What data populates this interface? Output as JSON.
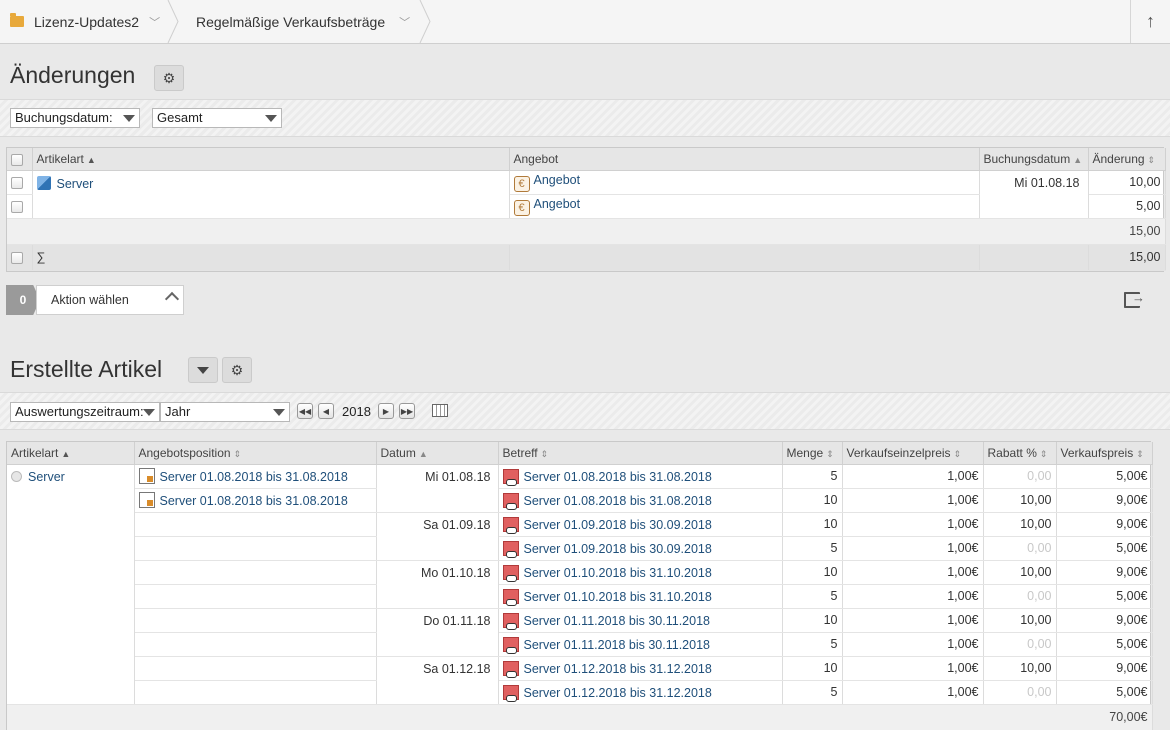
{
  "breadcrumb": {
    "items": [
      {
        "label": "Lizenz-Updates2"
      },
      {
        "label": "Regelmäßige Verkaufsbeträge"
      }
    ],
    "up_label": "↑"
  },
  "changes": {
    "title": "Änderungen",
    "filter": {
      "field": "Buchungsdatum:",
      "range": "Gesamt"
    },
    "columns": {
      "artikelart": "Artikelart",
      "angebot": "Angebot",
      "buchungsdatum": "Buchungsdatum",
      "aenderung": "Änderung"
    },
    "rows": [
      {
        "artikelart": "Server",
        "angebot": "Angebot",
        "buchungsdatum": "Mi 01.08.18",
        "aenderung": "10,00"
      },
      {
        "artikelart": "",
        "angebot": "Angebot",
        "buchungsdatum": "",
        "aenderung": "5,00"
      }
    ],
    "total": "15,00",
    "sigma_label": "∑",
    "sigma_total": "15,00",
    "action": {
      "count": "0",
      "label": "Aktion wählen"
    }
  },
  "articles": {
    "title": "Erstellte Artikel",
    "filter": {
      "field": "Auswertungszeitraum:",
      "range": "Jahr",
      "year": "2018"
    },
    "columns": {
      "artikelart": "Artikelart",
      "angebotsposition": "Angebotsposition",
      "datum": "Datum",
      "betreff": "Betreff",
      "menge": "Menge",
      "vkeinzel": "Verkaufseinzelpreis",
      "rabatt": "Rabatt %",
      "vkpreis": "Verkaufspreis"
    },
    "group_label": "Server",
    "rows": [
      {
        "position": "Server 01.08.2018 bis 31.08.2018",
        "datum": "Mi 01.08.18",
        "betreff": "Server 01.08.2018 bis 31.08.2018",
        "menge": "5",
        "einzel": "1,00€",
        "rabatt": "0,00",
        "rabatt_muted": true,
        "preis": "5,00€"
      },
      {
        "position": "Server 01.08.2018 bis 31.08.2018",
        "datum": "",
        "betreff": "Server 01.08.2018 bis 31.08.2018",
        "menge": "10",
        "einzel": "1,00€",
        "rabatt": "10,00",
        "rabatt_muted": false,
        "preis": "9,00€"
      },
      {
        "position": "",
        "datum": "Sa 01.09.18",
        "betreff": "Server 01.09.2018 bis 30.09.2018",
        "menge": "10",
        "einzel": "1,00€",
        "rabatt": "10,00",
        "rabatt_muted": false,
        "preis": "9,00€"
      },
      {
        "position": "",
        "datum": "",
        "betreff": "Server 01.09.2018 bis 30.09.2018",
        "menge": "5",
        "einzel": "1,00€",
        "rabatt": "0,00",
        "rabatt_muted": true,
        "preis": "5,00€"
      },
      {
        "position": "",
        "datum": "Mo 01.10.18",
        "betreff": "Server 01.10.2018 bis 31.10.2018",
        "menge": "10",
        "einzel": "1,00€",
        "rabatt": "10,00",
        "rabatt_muted": false,
        "preis": "9,00€"
      },
      {
        "position": "",
        "datum": "",
        "betreff": "Server 01.10.2018 bis 31.10.2018",
        "menge": "5",
        "einzel": "1,00€",
        "rabatt": "0,00",
        "rabatt_muted": true,
        "preis": "5,00€"
      },
      {
        "position": "",
        "datum": "Do 01.11.18",
        "betreff": "Server 01.11.2018 bis 30.11.2018",
        "menge": "10",
        "einzel": "1,00€",
        "rabatt": "10,00",
        "rabatt_muted": false,
        "preis": "9,00€"
      },
      {
        "position": "",
        "datum": "",
        "betreff": "Server 01.11.2018 bis 30.11.2018",
        "menge": "5",
        "einzel": "1,00€",
        "rabatt": "0,00",
        "rabatt_muted": true,
        "preis": "5,00€"
      },
      {
        "position": "",
        "datum": "Sa 01.12.18",
        "betreff": "Server 01.12.2018 bis 31.12.2018",
        "menge": "10",
        "einzel": "1,00€",
        "rabatt": "10,00",
        "rabatt_muted": false,
        "preis": "9,00€"
      },
      {
        "position": "",
        "datum": "",
        "betreff": "Server 01.12.2018 bis 31.12.2018",
        "menge": "5",
        "einzel": "1,00€",
        "rabatt": "0,00",
        "rabatt_muted": true,
        "preis": "5,00€"
      }
    ],
    "total": "70,00€"
  },
  "icons": {
    "settings": "gear-icon",
    "dropdown": "chevron-down-icon",
    "export": "export-icon",
    "calendar": "calendar-icon"
  }
}
